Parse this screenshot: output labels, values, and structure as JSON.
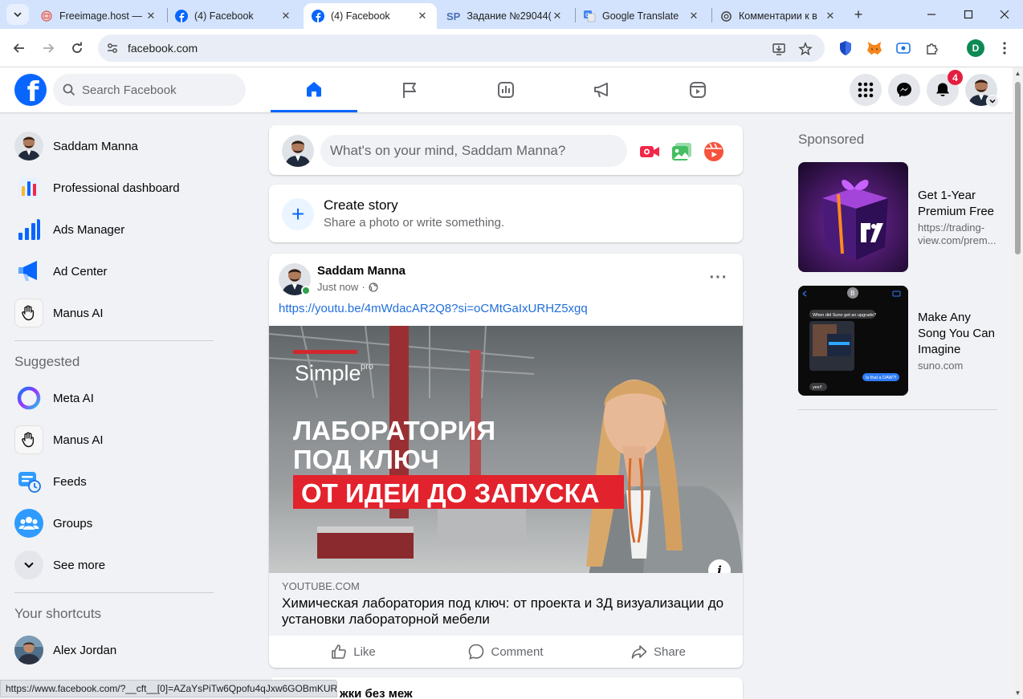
{
  "browser": {
    "tabs": [
      {
        "title": "Freeimage.host —",
        "favicon": "freeimage-icon",
        "active": false
      },
      {
        "title": "(4) Facebook",
        "favicon": "facebook-icon",
        "active": false
      },
      {
        "title": "(4) Facebook",
        "favicon": "facebook-icon",
        "active": true
      },
      {
        "title": "Задание №29044(",
        "favicon": "sp-icon",
        "active": false
      },
      {
        "title": "Google Translate",
        "favicon": "translate-icon",
        "active": false
      },
      {
        "title": "Комментарии к в",
        "favicon": "openai-icon",
        "active": false
      }
    ],
    "sp_favicon_text": "SP",
    "url": "facebook.com",
    "profile_initial": "D",
    "status_url": "https://www.facebook.com/?__cft__[0]=AZaYsPiTw6Qpofu4qJxw6GOBmKUR..."
  },
  "header": {
    "search_placeholder": "Search Facebook",
    "notification_count": "4",
    "brand_color": "#0866ff"
  },
  "sidebar": {
    "items": [
      {
        "label": "Saddam Manna",
        "icon": "profile-avatar"
      },
      {
        "label": "Professional dashboard",
        "icon": "dashboard-icon"
      },
      {
        "label": "Ads Manager",
        "icon": "ads-manager-icon"
      },
      {
        "label": "Ad Center",
        "icon": "megaphone-icon"
      },
      {
        "label": "Manus AI",
        "icon": "manus-icon"
      }
    ],
    "suggested_heading": "Suggested",
    "suggested": [
      {
        "label": "Meta AI",
        "icon": "meta-ai-icon"
      },
      {
        "label": "Manus AI",
        "icon": "manus-icon"
      },
      {
        "label": "Feeds",
        "icon": "feeds-icon"
      },
      {
        "label": "Groups",
        "icon": "groups-icon"
      },
      {
        "label": "See more",
        "icon": "chevron-down-icon"
      }
    ],
    "shortcuts_heading": "Your shortcuts",
    "shortcuts": [
      {
        "label": "Alex Jordan",
        "icon": "shortcut-avatar"
      }
    ]
  },
  "composer": {
    "placeholder": "What's on your mind, Saddam Manna?"
  },
  "story": {
    "title": "Create story",
    "subtitle": "Share a photo or write something."
  },
  "post": {
    "author": "Saddam Manna",
    "time": "Just now",
    "link": "https://youtu.be/4mWdacAR2Q8?si=oCMtGaIxURHZ5xgq",
    "image": {
      "brand": "Simple",
      "brand_sup": "pro",
      "headline_1": "ЛАБОРАТОРИЯ",
      "headline_2": "ПОД КЛЮЧ",
      "banner": "ОТ ИДЕИ ДО ЗАПУСКА"
    },
    "domain": "YOUTUBE.COM",
    "link_title": "Химическая лаборатория под ключ: от проекта и 3Д визуализации до установки лабораторной мебели",
    "actions": {
      "like": "Like",
      "comment": "Comment",
      "share": "Share"
    }
  },
  "next_post_partial": "жки без меж",
  "sponsored": {
    "heading": "Sponsored",
    "ads": [
      {
        "title": "Get 1-Year Premium Free",
        "url": "https://trading-view.com/prem..."
      },
      {
        "title": "Make Any Song You Can Imagine",
        "url": "suno.com"
      }
    ],
    "chat_preview": {
      "q": "When did Suno get an upgrade?",
      "a": "Is that a DAW?!",
      "b": "yes!!"
    }
  }
}
